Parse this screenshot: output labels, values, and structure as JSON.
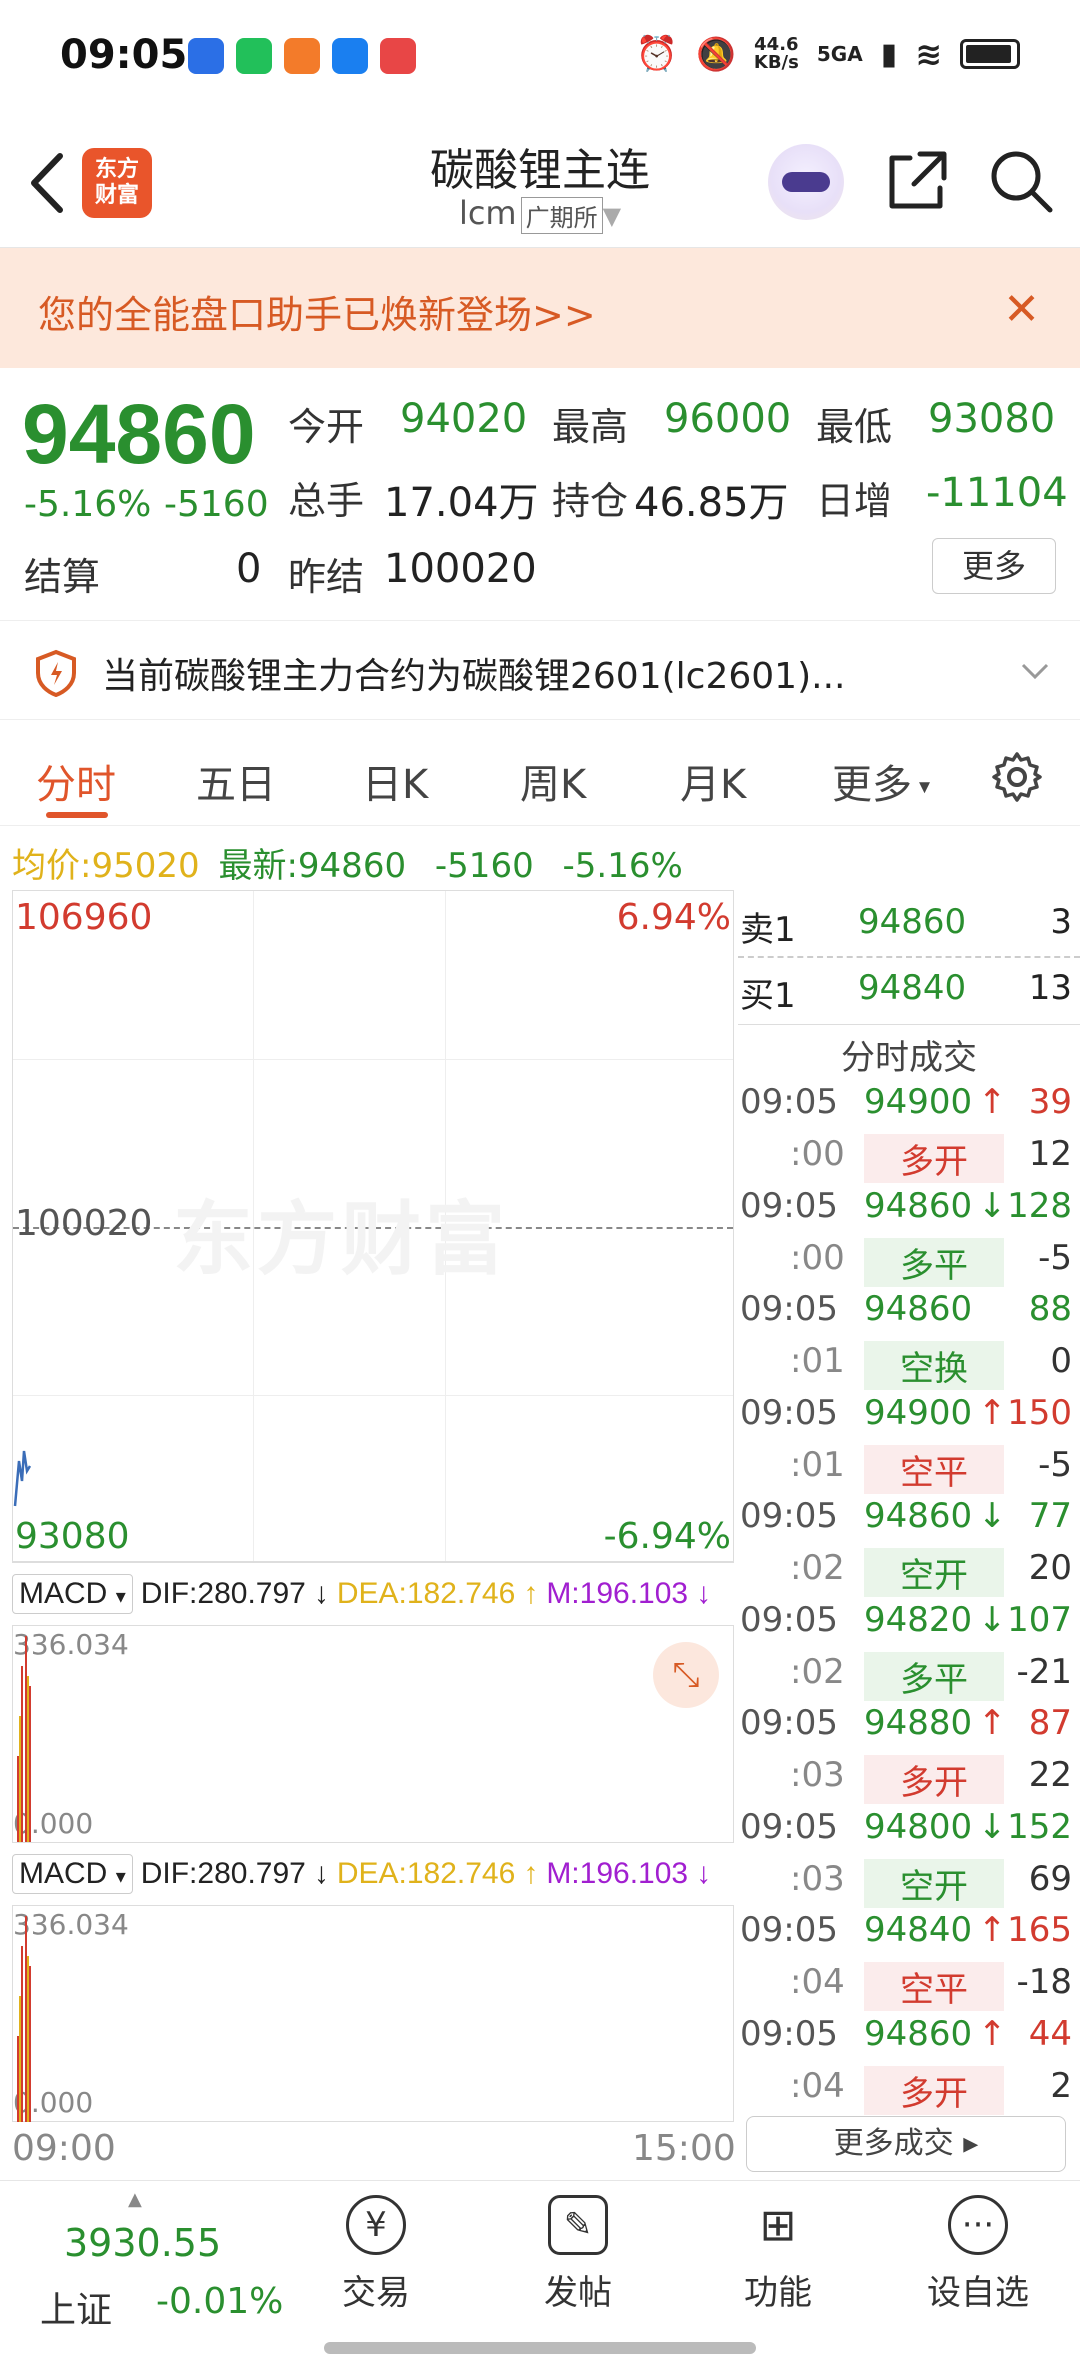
{
  "status_bar": {
    "time": "09:05",
    "net_speed": "44.6\nKB/s",
    "signal": "5GA"
  },
  "header": {
    "logo_text": "东方\n财富",
    "title": "碳酸锂主连",
    "code": "lcm",
    "exchange": "广期所"
  },
  "banner": {
    "text": "您的全能盘口助手已焕新登场>>"
  },
  "quote": {
    "price": "94860",
    "change_pct": "-5.16%",
    "change": "-5160",
    "open_label": "今开",
    "open": "94020",
    "high_label": "最高",
    "high": "96000",
    "low_label": "最低",
    "low": "93080",
    "volume_label": "总手",
    "volume": "17.04万",
    "oi_label": "持仓",
    "oi": "46.85万",
    "daily_inc_label": "日增",
    "daily_inc": "-11104",
    "settle_label": "结算",
    "settle": "0",
    "prev_settle_label": "昨结",
    "prev_settle": "100020",
    "more_button": "更多"
  },
  "notice": {
    "text": "当前碳酸锂主力合约为碳酸锂2601(lc2601)..."
  },
  "tabs": [
    "分时",
    "五日",
    "日K",
    "周K",
    "月K",
    "更多"
  ],
  "avg_line": {
    "avg_label": "均价:",
    "avg": "95020",
    "latest_label": "最新:",
    "latest": "94860",
    "chg": "-5160",
    "pct": "-5.16%"
  },
  "chart": {
    "top_price": "106960",
    "top_pct": "6.94%",
    "mid_price": "100020",
    "bottom_price": "93080",
    "bottom_pct": "-6.94%",
    "watermark": "东方财富",
    "time_start": "09:00",
    "time_end": "15:00"
  },
  "macd": {
    "sel": "MACD",
    "dif": "DIF:280.797",
    "dea": "DEA:182.746",
    "m": "M:196.103",
    "top": "336.034",
    "bottom": "0.000"
  },
  "orderbook": {
    "sell_label": "卖1",
    "sell_price": "94860",
    "sell_qty": "3",
    "buy_label": "买1",
    "buy_price": "94840",
    "buy_qty": "13"
  },
  "ticks_title": "分时成交",
  "ticks": [
    {
      "time": "09:05",
      "sec": ":00",
      "price": "94900",
      "dir": "up",
      "vol": "39",
      "type": "多开",
      "chg": "12",
      "type_color": "red",
      "price_color": "green"
    },
    {
      "time": "09:05",
      "sec": ":00",
      "price": "94860",
      "dir": "down",
      "vol": "128",
      "type": "多平",
      "chg": "-5",
      "type_color": "green",
      "price_color": "green"
    },
    {
      "time": "09:05",
      "sec": ":01",
      "price": "94860",
      "dir": "",
      "vol": "88",
      "type": "空换",
      "chg": "0",
      "type_color": "green",
      "price_color": "green"
    },
    {
      "time": "09:05",
      "sec": ":01",
      "price": "94900",
      "dir": "up",
      "vol": "150",
      "type": "空平",
      "chg": "-5",
      "type_color": "red",
      "price_color": "green"
    },
    {
      "time": "09:05",
      "sec": ":02",
      "price": "94860",
      "dir": "down",
      "vol": "77",
      "type": "空开",
      "chg": "20",
      "type_color": "green",
      "price_color": "green"
    },
    {
      "time": "09:05",
      "sec": ":02",
      "price": "94820",
      "dir": "down",
      "vol": "107",
      "type": "多平",
      "chg": "-21",
      "type_color": "green",
      "price_color": "green"
    },
    {
      "time": "09:05",
      "sec": ":03",
      "price": "94880",
      "dir": "up",
      "vol": "87",
      "type": "多开",
      "chg": "22",
      "type_color": "red",
      "price_color": "green"
    },
    {
      "time": "09:05",
      "sec": ":03",
      "price": "94800",
      "dir": "down",
      "vol": "152",
      "type": "空开",
      "chg": "69",
      "type_color": "green",
      "price_color": "green"
    },
    {
      "time": "09:05",
      "sec": ":04",
      "price": "94840",
      "dir": "up",
      "vol": "165",
      "type": "空平",
      "chg": "-18",
      "type_color": "red",
      "price_color": "green"
    },
    {
      "time": "09:05",
      "sec": ":04",
      "price": "94860",
      "dir": "up",
      "vol": "44",
      "type": "多开",
      "chg": "2",
      "type_color": "red",
      "price_color": "green"
    }
  ],
  "more_ticks": "更多成交 ▸",
  "bottom_nav": {
    "index_value": "3930.55",
    "index_name": "上证",
    "index_pct": "-0.01%",
    "trade": "交易",
    "post": "发帖",
    "func": "功能",
    "watch": "设自选"
  }
}
